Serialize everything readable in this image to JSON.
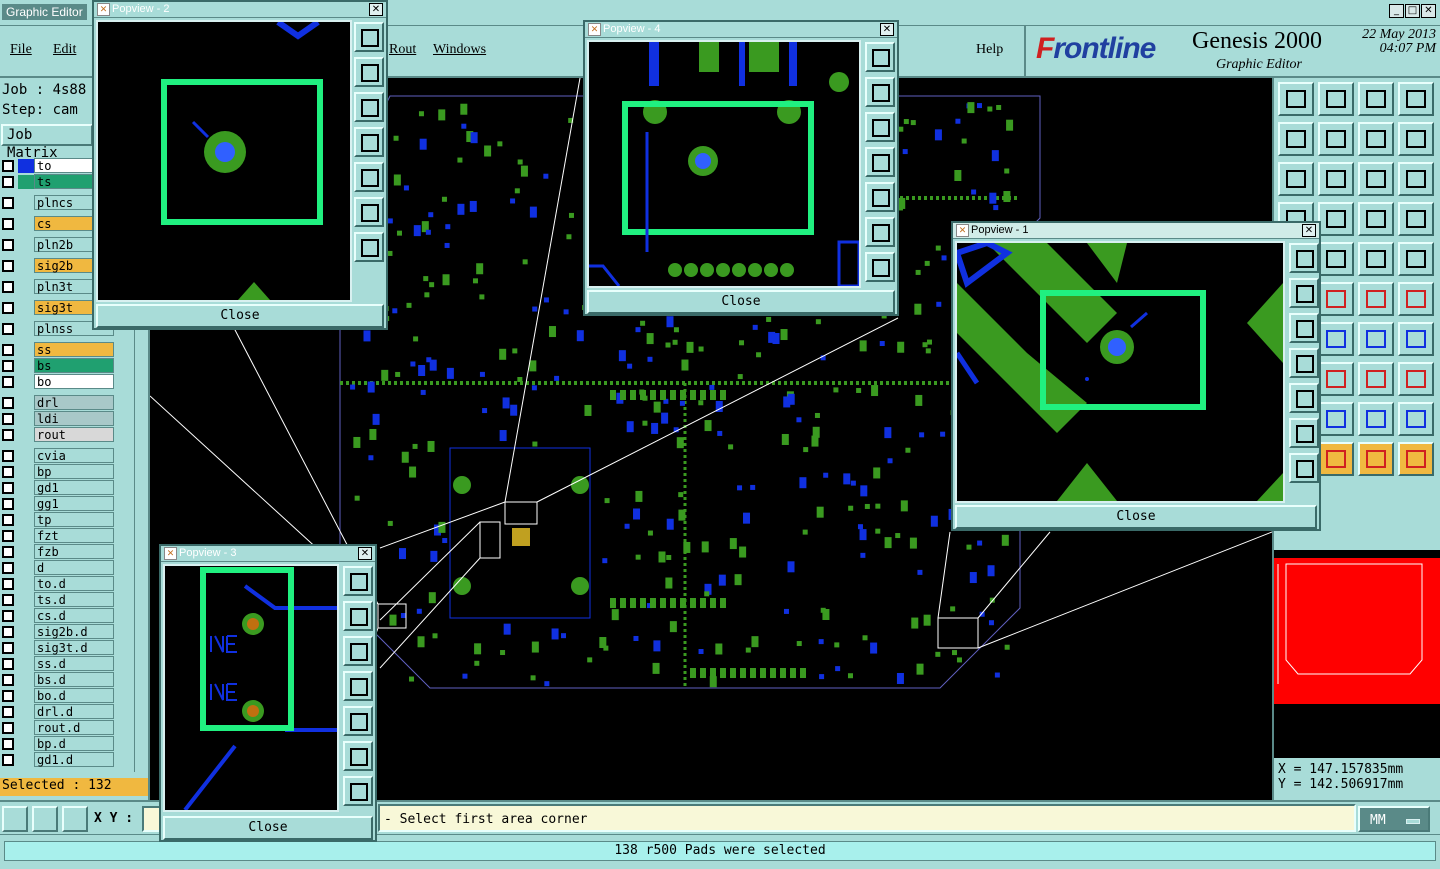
{
  "window": {
    "title": "Graphic Editor",
    "controls": [
      "_",
      "□",
      "✕"
    ]
  },
  "menu": {
    "file": "File",
    "edit": "Edit",
    "rout": "Rout",
    "windows": "Windows",
    "help": "Help"
  },
  "brand": {
    "logo_prefix": "F",
    "logo_rest": "rontline",
    "product": "Genesis 2000",
    "subtitle": "Graphic Editor",
    "date": "22 May 2013",
    "time": "04:07 PM"
  },
  "job": {
    "job_label": "Job : 4s88",
    "step_label": "Step: cam",
    "matrix_button": "Job Matrix"
  },
  "layers": [
    {
      "name": "to",
      "swatch": "#1030e0",
      "bg": "#ffffff"
    },
    {
      "name": "ts",
      "swatch": "#20a070",
      "bg": "#20a070"
    },
    {
      "name": "plncs",
      "swatch": "",
      "bg": "#a8dcd8"
    },
    {
      "name": "cs",
      "swatch": "",
      "bg": "#f0b840"
    },
    {
      "name": "pln2b",
      "swatch": "",
      "bg": "#a8dcd8"
    },
    {
      "name": "sig2b",
      "swatch": "",
      "bg": "#f0b840"
    },
    {
      "name": "pln3t",
      "swatch": "",
      "bg": "#a8dcd8"
    },
    {
      "name": "sig3t",
      "swatch": "",
      "bg": "#f0b840"
    },
    {
      "name": "plnss",
      "swatch": "",
      "bg": "#a8dcd8"
    },
    {
      "name": "ss",
      "swatch": "",
      "bg": "#f0b840"
    },
    {
      "name": "bs",
      "swatch": "",
      "bg": "#20a070"
    },
    {
      "name": "bo",
      "swatch": "",
      "bg": "#ffffff"
    },
    {
      "name": "drl",
      "swatch": "",
      "bg": "#a8c8c8"
    },
    {
      "name": "ldi",
      "swatch": "",
      "bg": "#a8c8c8"
    },
    {
      "name": "rout",
      "swatch": "",
      "bg": "#d8d8d8"
    },
    {
      "name": "cvia",
      "swatch": "",
      "bg": "#a8dcd8"
    },
    {
      "name": "bp",
      "swatch": "",
      "bg": "#a8dcd8"
    },
    {
      "name": "gd1",
      "swatch": "",
      "bg": "#a8dcd8"
    },
    {
      "name": "gg1",
      "swatch": "",
      "bg": "#a8dcd8"
    },
    {
      "name": "tp",
      "swatch": "",
      "bg": "#a8dcd8"
    },
    {
      "name": "fzt",
      "swatch": "",
      "bg": "#a8dcd8"
    },
    {
      "name": "fzb",
      "swatch": "",
      "bg": "#a8dcd8"
    },
    {
      "name": "d",
      "swatch": "",
      "bg": "#a8dcd8"
    },
    {
      "name": "to.d",
      "swatch": "",
      "bg": "#a8dcd8"
    },
    {
      "name": "ts.d",
      "swatch": "",
      "bg": "#a8dcd8"
    },
    {
      "name": "cs.d",
      "swatch": "",
      "bg": "#a8dcd8"
    },
    {
      "name": "sig2b.d",
      "swatch": "",
      "bg": "#a8dcd8"
    },
    {
      "name": "sig3t.d",
      "swatch": "",
      "bg": "#a8dcd8"
    },
    {
      "name": "ss.d",
      "swatch": "",
      "bg": "#a8dcd8"
    },
    {
      "name": "bs.d",
      "swatch": "",
      "bg": "#a8dcd8"
    },
    {
      "name": "bo.d",
      "swatch": "",
      "bg": "#a8dcd8"
    },
    {
      "name": "drl.d",
      "swatch": "",
      "bg": "#a8dcd8"
    },
    {
      "name": "rout.d",
      "swatch": "",
      "bg": "#a8dcd8"
    },
    {
      "name": "bp.d",
      "swatch": "",
      "bg": "#a8dcd8"
    },
    {
      "name": "gd1.d",
      "swatch": "",
      "bg": "#a8dcd8"
    }
  ],
  "selected": "Selected : 132",
  "popviews": {
    "p1": {
      "title": "Popview - 1",
      "close": "Close"
    },
    "p2": {
      "title": "Popview - 2",
      "close": "Close"
    },
    "p3": {
      "title": "Popview - 3",
      "close": "Close"
    },
    "p4": {
      "title": "Popview - 4",
      "close": "Close"
    }
  },
  "coords": {
    "x": "X = 147.157835mm",
    "y": "Y = 142.506917mm"
  },
  "bottom": {
    "xy_label": "X Y :",
    "prompt": "- Select first area corner",
    "units": "MM"
  },
  "status": "138 r500 Pads were selected",
  "colors": {
    "panel": "#a8dcd8",
    "pcb_green": "#3a9a20",
    "pcb_blue": "#1030e0",
    "highlight": "#20f080",
    "selection": "#f0b840",
    "overview": "#ff0000"
  }
}
